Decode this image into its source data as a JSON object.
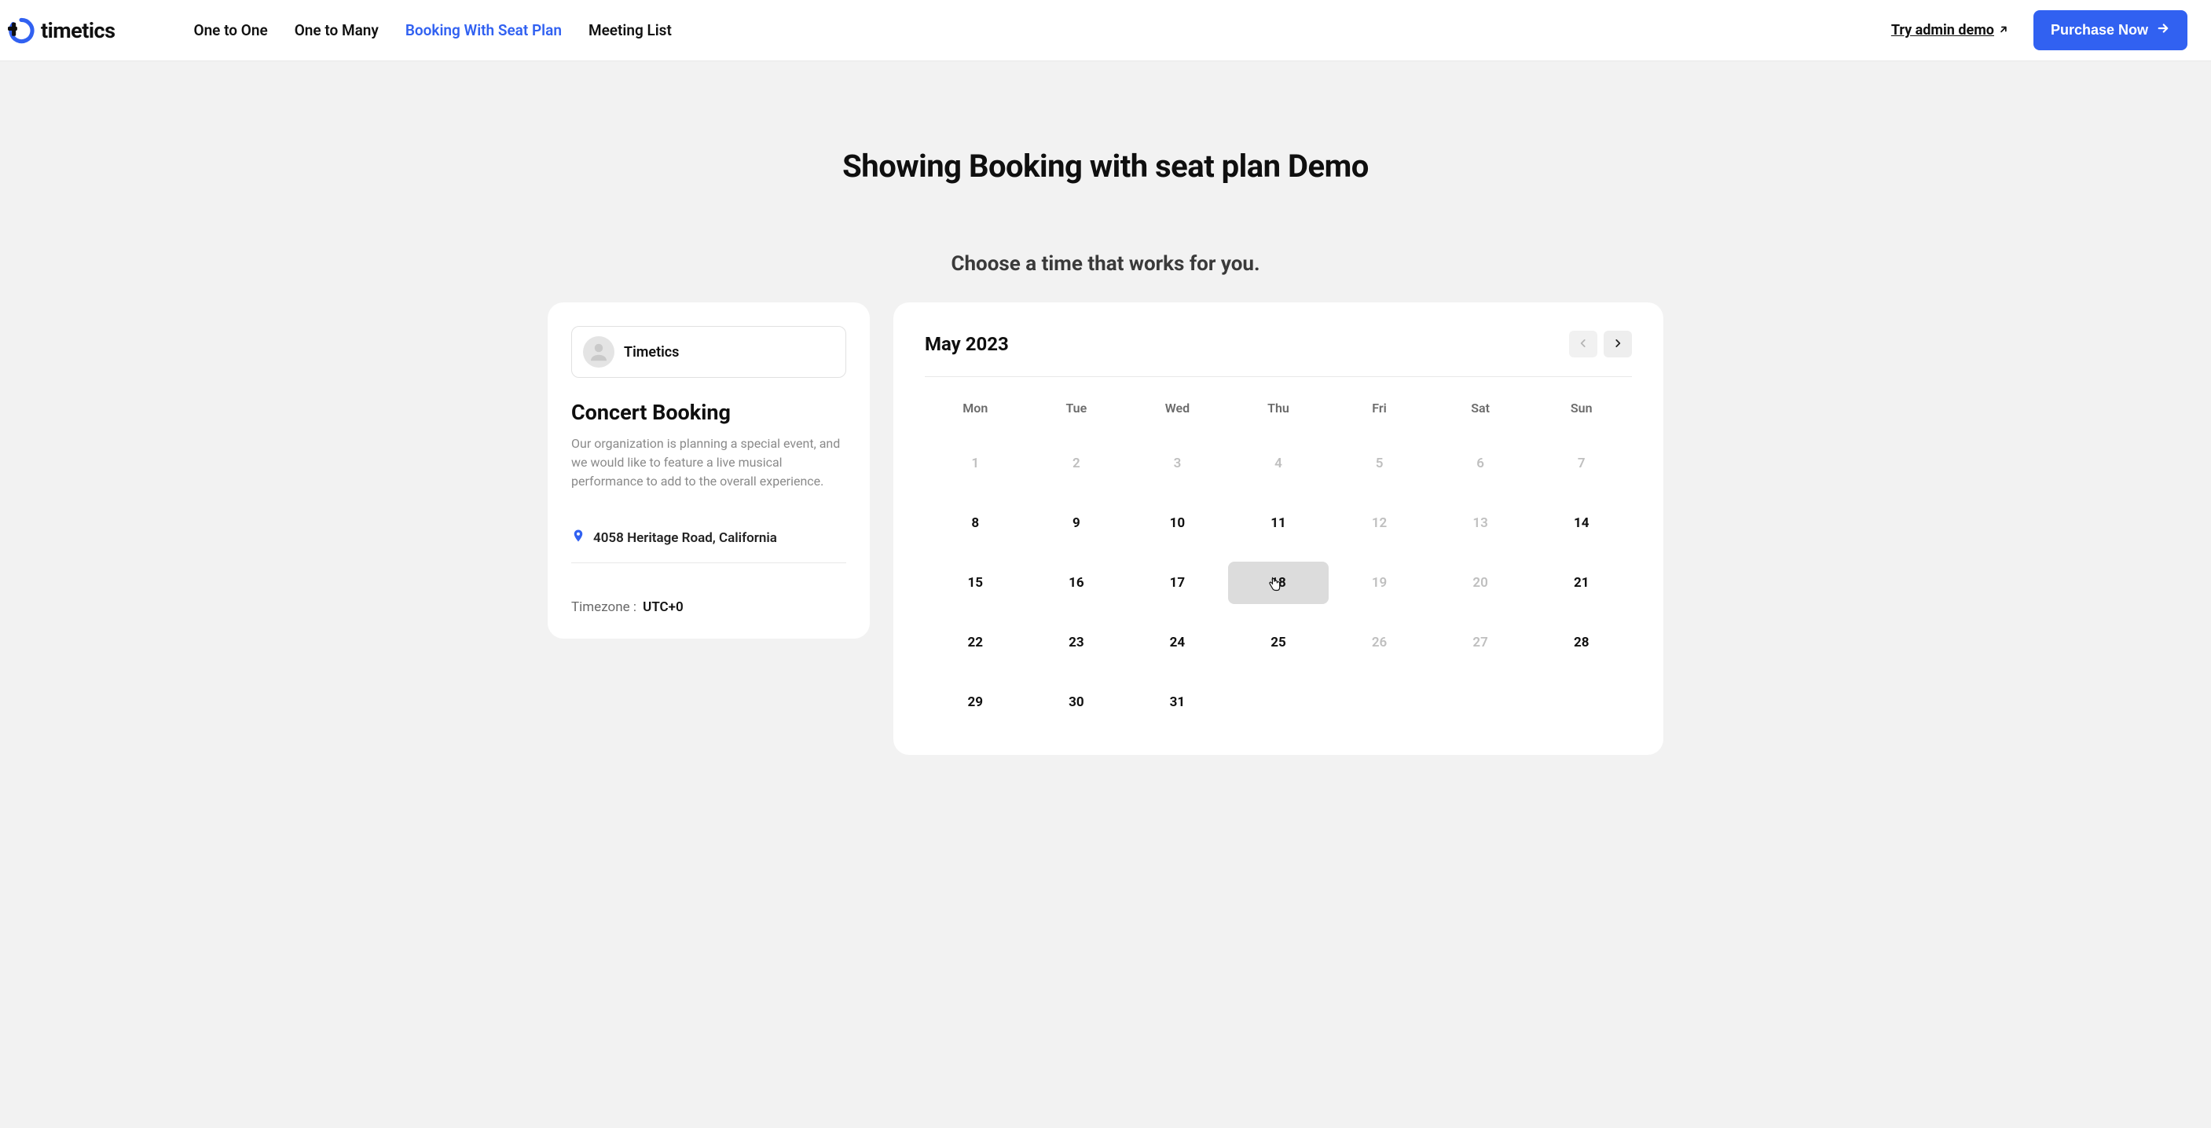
{
  "brand": {
    "name": "timetics"
  },
  "nav": {
    "items": [
      {
        "label": "One to One",
        "active": false
      },
      {
        "label": "One to Many",
        "active": false
      },
      {
        "label": "Booking With Seat Plan",
        "active": true
      },
      {
        "label": "Meeting List",
        "active": false
      }
    ],
    "admin_demo": "Try admin demo",
    "purchase": "Purchase Now"
  },
  "page": {
    "title": "Showing Booking with seat plan Demo",
    "subtitle": "Choose a time that works for you."
  },
  "info": {
    "owner": "Timetics",
    "title": "Concert Booking",
    "description": "Our organization is planning a special event, and we would like to feature a live musical performance to add to the overall experience.",
    "location": "4058 Heritage Road, California",
    "timezone_label": "Timezone :",
    "timezone_value": "UTC+0"
  },
  "calendar": {
    "month_label": "May 2023",
    "dows": [
      "Mon",
      "Tue",
      "Wed",
      "Thu",
      "Fri",
      "Sat",
      "Sun"
    ],
    "days": [
      {
        "n": "1",
        "disabled": true
      },
      {
        "n": "2",
        "disabled": true
      },
      {
        "n": "3",
        "disabled": true
      },
      {
        "n": "4",
        "disabled": true
      },
      {
        "n": "5",
        "disabled": true
      },
      {
        "n": "6",
        "disabled": true
      },
      {
        "n": "7",
        "disabled": true
      },
      {
        "n": "8",
        "disabled": false
      },
      {
        "n": "9",
        "disabled": false
      },
      {
        "n": "10",
        "disabled": false
      },
      {
        "n": "11",
        "disabled": false
      },
      {
        "n": "12",
        "disabled": true
      },
      {
        "n": "13",
        "disabled": true
      },
      {
        "n": "14",
        "disabled": false
      },
      {
        "n": "15",
        "disabled": false
      },
      {
        "n": "16",
        "disabled": false
      },
      {
        "n": "17",
        "disabled": false
      },
      {
        "n": "18",
        "disabled": false,
        "hovered": true
      },
      {
        "n": "19",
        "disabled": true
      },
      {
        "n": "20",
        "disabled": true
      },
      {
        "n": "21",
        "disabled": false
      },
      {
        "n": "22",
        "disabled": false
      },
      {
        "n": "23",
        "disabled": false
      },
      {
        "n": "24",
        "disabled": false
      },
      {
        "n": "25",
        "disabled": false
      },
      {
        "n": "26",
        "disabled": true
      },
      {
        "n": "27",
        "disabled": true
      },
      {
        "n": "28",
        "disabled": false
      },
      {
        "n": "29",
        "disabled": false
      },
      {
        "n": "30",
        "disabled": false
      },
      {
        "n": "31",
        "disabled": false
      }
    ],
    "prev_enabled": false,
    "next_enabled": true
  }
}
